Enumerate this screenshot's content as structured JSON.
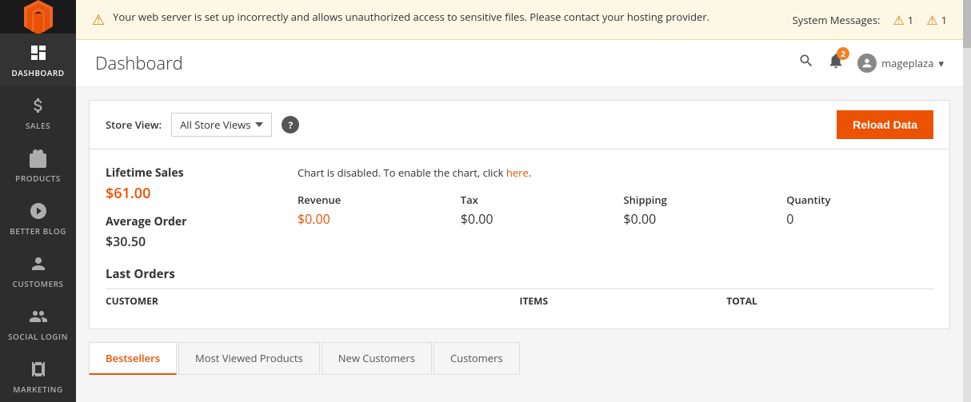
{
  "sidebar": {
    "logo_alt": "Magento Logo",
    "items": [
      {
        "id": "dashboard",
        "label": "DASHBOARD",
        "icon": "dashboard-icon",
        "active": true
      },
      {
        "id": "sales",
        "label": "SALES",
        "icon": "sales-icon",
        "active": false
      },
      {
        "id": "products",
        "label": "PRODUCTS",
        "icon": "products-icon",
        "active": false
      },
      {
        "id": "better-blog",
        "label": "BETTER BLOG",
        "icon": "blog-icon",
        "active": false
      },
      {
        "id": "customers",
        "label": "CUSTOMERS",
        "icon": "customers-icon",
        "active": false
      },
      {
        "id": "social-login",
        "label": "SOCIAL LOGIN",
        "icon": "social-login-icon",
        "active": false
      },
      {
        "id": "marketing",
        "label": "MARKETING",
        "icon": "marketing-icon",
        "active": false
      }
    ]
  },
  "warning": {
    "message": "Your web server is set up incorrectly and allows unauthorized access to sensitive files. Please contact your hosting provider.",
    "system_messages_label": "System Messages:",
    "badge1_count": "1",
    "badge2_count": "1"
  },
  "header": {
    "title": "Dashboard",
    "notification_count": "2",
    "username": "mageplaza"
  },
  "store_view": {
    "label": "Store View:",
    "selected": "All Store Views",
    "reload_button": "Reload Data"
  },
  "metrics": {
    "lifetime_sales_label": "Lifetime Sales",
    "lifetime_sales_value": "$61.00",
    "avg_order_label": "Average Order",
    "avg_order_value": "$30.50"
  },
  "chart": {
    "disabled_message": "Chart is disabled. To enable the chart, click",
    "link_text": "here",
    "stats": [
      {
        "label": "Revenue",
        "value": "$0.00",
        "is_orange": true
      },
      {
        "label": "Tax",
        "value": "$0.00",
        "is_orange": false
      },
      {
        "label": "Shipping",
        "value": "$0.00",
        "is_orange": false
      },
      {
        "label": "Quantity",
        "value": "0",
        "is_orange": false
      }
    ]
  },
  "last_orders": {
    "title": "Last Orders",
    "columns": [
      "Customer",
      "Items",
      "Total"
    ]
  },
  "tabs": [
    {
      "id": "bestsellers",
      "label": "Bestsellers",
      "active": true
    },
    {
      "id": "most-viewed",
      "label": "Most Viewed Products",
      "active": false
    },
    {
      "id": "new-customers",
      "label": "New Customers",
      "active": false
    },
    {
      "id": "customers",
      "label": "Customers",
      "active": false
    }
  ]
}
